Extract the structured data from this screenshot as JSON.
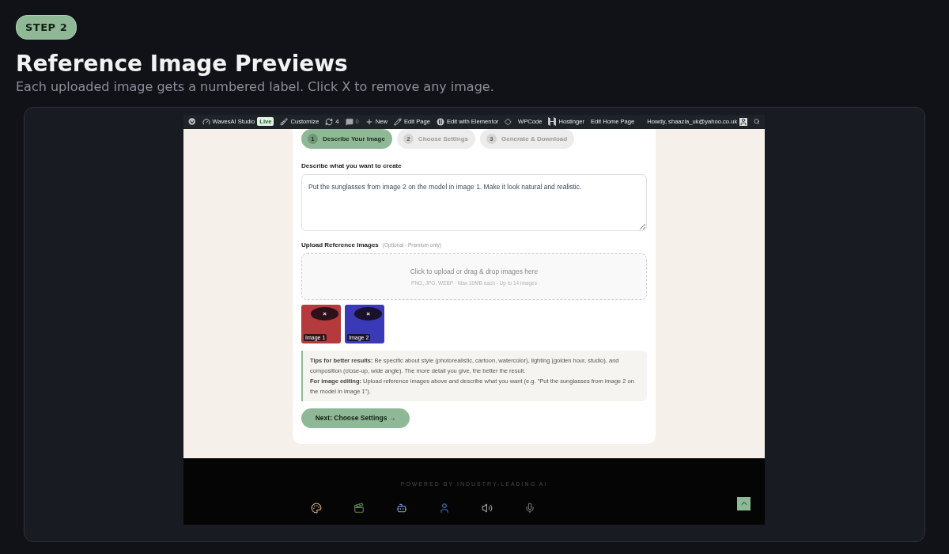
{
  "step_badge": "STEP 2",
  "title": "Reference Image Previews",
  "subtitle": "Each uploaded image gets a numbered label. Click X to remove any image.",
  "admin_bar": {
    "items": [
      {
        "kind": "wordpress"
      },
      {
        "kind": "gauge",
        "label": "WavesAI Studio",
        "badge": "Live"
      },
      {
        "kind": "brush",
        "label": "Customize"
      },
      {
        "kind": "refresh",
        "label": "4"
      },
      {
        "kind": "comment",
        "label": "0",
        "muted": true
      },
      {
        "kind": "plus",
        "label": "New"
      },
      {
        "kind": "pencil",
        "label": "Edit Page"
      },
      {
        "kind": "elementor",
        "label": "Edit with Elementor"
      },
      {
        "kind": "diamond"
      },
      {
        "kind": "none",
        "label": "WPCode"
      },
      {
        "kind": "hostinger",
        "label": "Hostinger"
      },
      {
        "kind": "none",
        "label": "Edit Home Page"
      }
    ],
    "greeting": "Howdy, shaazia_uk@yahoo.co.uk"
  },
  "steps": [
    {
      "number": "1",
      "label": "Describe Your Image",
      "selected": true
    },
    {
      "number": "2",
      "label": "Choose Settings",
      "selected": false
    },
    {
      "number": "3",
      "label": "Generate & Download",
      "selected": false
    }
  ],
  "prompt": {
    "label": "Describe what you want to create",
    "value": "Put the sunglasses from image 2 on the model in image 1. Make it look natural and realistic."
  },
  "upload": {
    "label": "Upload Reference Images",
    "note": "(Optional - Premium only)",
    "drop_text": "Click to upload or drag & drop images here",
    "drop_hint": "PNG, JPG, WEBP - Max 10MB each - Up to 14 images"
  },
  "images": [
    {
      "label": "Image 1",
      "remove": "×",
      "color": "#b43a3e"
    },
    {
      "label": "Image 2",
      "remove": "×",
      "color": "#3a3ab8"
    }
  ],
  "tips": [
    "**Tips for better results:** Be specific about style (photorealistic, cartoon, watercolor), lighting (golden hour, studio), and composition (close-up, wide angle). The more detail you give, the better the result.",
    "**For image editing:** Upload reference images above and describe what you want (e.g. \"Put the sunglasses from image 2 on the model in image 1\")."
  ],
  "next_button": "Next: Choose Settings →",
  "footer": {
    "powered_by": "POWERED BY INDUSTRY-LEADING AI",
    "icons": [
      {
        "kind": "palette"
      },
      {
        "kind": "clapper"
      },
      {
        "kind": "robot"
      },
      {
        "kind": "speaker-head"
      },
      {
        "kind": "volume"
      },
      {
        "kind": "mic"
      }
    ]
  }
}
